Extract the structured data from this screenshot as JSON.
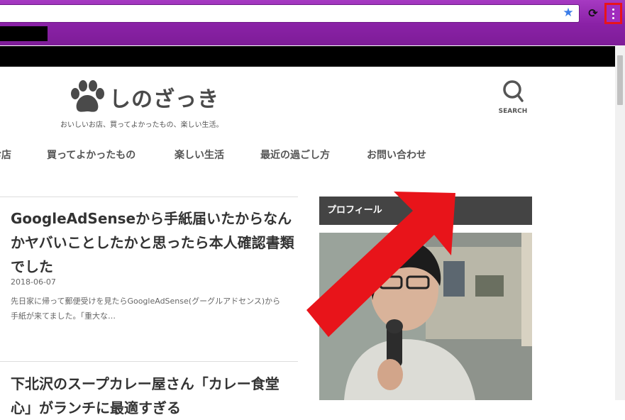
{
  "browser": {
    "star_icon": "star-icon",
    "reload_icon": "reload-icon",
    "menu_icon": "vertical-dots-icon",
    "highlight_color": "#e8141a",
    "theme_color": "#8a21a6"
  },
  "site": {
    "title": "しのざっき",
    "tagline": "おいしいお店、買ってよかったもの、楽しい生活。",
    "search_label": "SEARCH"
  },
  "nav": {
    "items": [
      "お店",
      "買ってよかったもの",
      "楽しい生活",
      "最近の過ごし方",
      "お問い合わせ"
    ]
  },
  "posts": [
    {
      "title": "GoogleAdSenseから手紙届いたからなんかヤバいことしたかと思ったら本人確認書類でした",
      "date": "2018-06-07",
      "excerpt": "先日家に帰って郵便受けを見たらGoogleAdSense(グーグルアドセンス)から手紙が来てました。「重大な…"
    },
    {
      "title": "下北沢のスープカレー屋さん「カレー食堂 心」がランチに最適すぎる"
    }
  ],
  "sidebar": {
    "heading": "プロフィール"
  },
  "annotation": {
    "arrow_color": "#e8141a"
  }
}
